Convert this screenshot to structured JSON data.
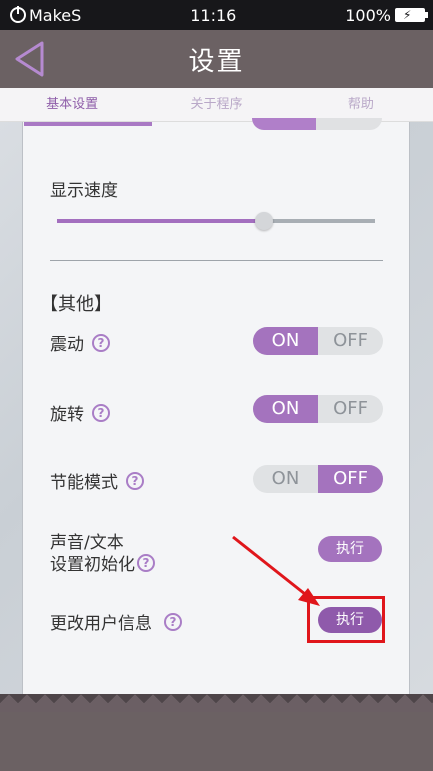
{
  "status_bar": {
    "carrier": "MakeS",
    "time": "11:16",
    "battery": "100%"
  },
  "header": {
    "title": "设置"
  },
  "tabs": [
    {
      "label": "基本设置",
      "active": true
    },
    {
      "label": "关于程序",
      "active": false
    },
    {
      "label": "帮助",
      "active": false
    }
  ],
  "settings": {
    "display_speed": {
      "label": "显示速度",
      "value_percent": 65
    },
    "other_section": "【其他】",
    "vibration": {
      "label": "震动",
      "on": "ON",
      "off": "OFF",
      "state": "ON"
    },
    "rotation": {
      "label": "旋转",
      "on": "ON",
      "off": "OFF",
      "state": "ON"
    },
    "power_saving": {
      "label": "节能模式",
      "on": "ON",
      "off": "OFF",
      "state": "OFF"
    },
    "reset": {
      "label_line1": "声音/文本",
      "label_line2": "设置初始化",
      "button": "执行"
    },
    "change_user": {
      "label": "更改用户信息",
      "button": "执行"
    }
  },
  "colors": {
    "accent": "#a473be",
    "highlight": "#e0161b",
    "header": "#6b6163"
  },
  "icons": [
    "power-icon",
    "battery-icon",
    "back-arrow-icon",
    "help-icon"
  ]
}
